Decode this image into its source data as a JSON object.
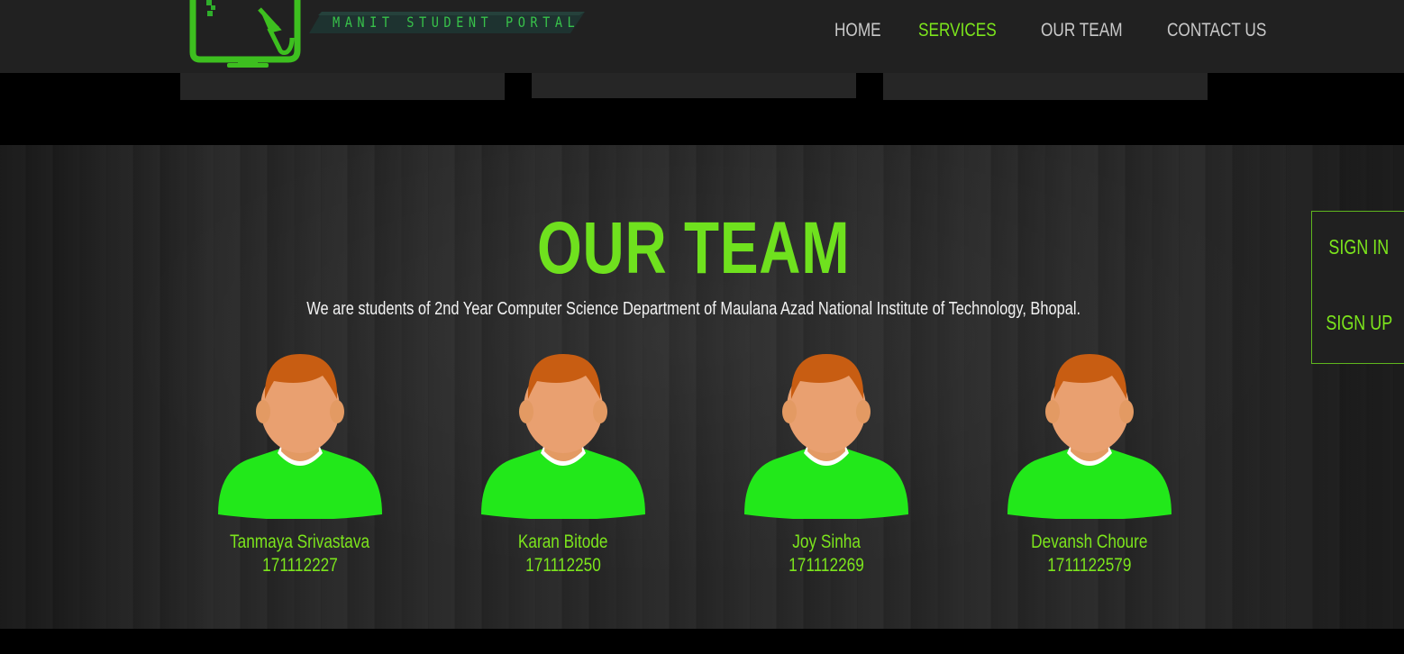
{
  "header": {
    "brand": "MANIT STUDENT PORTAL",
    "nav": [
      {
        "label": "HOME",
        "active": false
      },
      {
        "label": "SERVICES",
        "active": true
      },
      {
        "label": "OUR TEAM",
        "active": false
      },
      {
        "label": "CONTACT US",
        "active": false
      }
    ]
  },
  "team": {
    "title": "OUR TEAM",
    "subtitle": "We are students of 2nd Year Computer Science Department of Maulana Azad National Institute of Technology, Bhopal.",
    "members": [
      {
        "name": "Tanmaya Srivastava",
        "roll": "171112227"
      },
      {
        "name": "Karan Bitode",
        "roll": "171112250"
      },
      {
        "name": "Joy Sinha",
        "roll": "171112269"
      },
      {
        "name": "Devansh Choure",
        "roll": "1711122579"
      }
    ]
  },
  "auth": {
    "sign_in": "SIGN IN",
    "sign_up": "SIGN UP"
  },
  "colors": {
    "accent": "#7ce51c",
    "header_bg": "#212121",
    "shirt": "#22e81a",
    "hair": "#c85d12"
  },
  "icons": [
    "monitor-cursor-logo-icon",
    "user-avatar-icon"
  ]
}
